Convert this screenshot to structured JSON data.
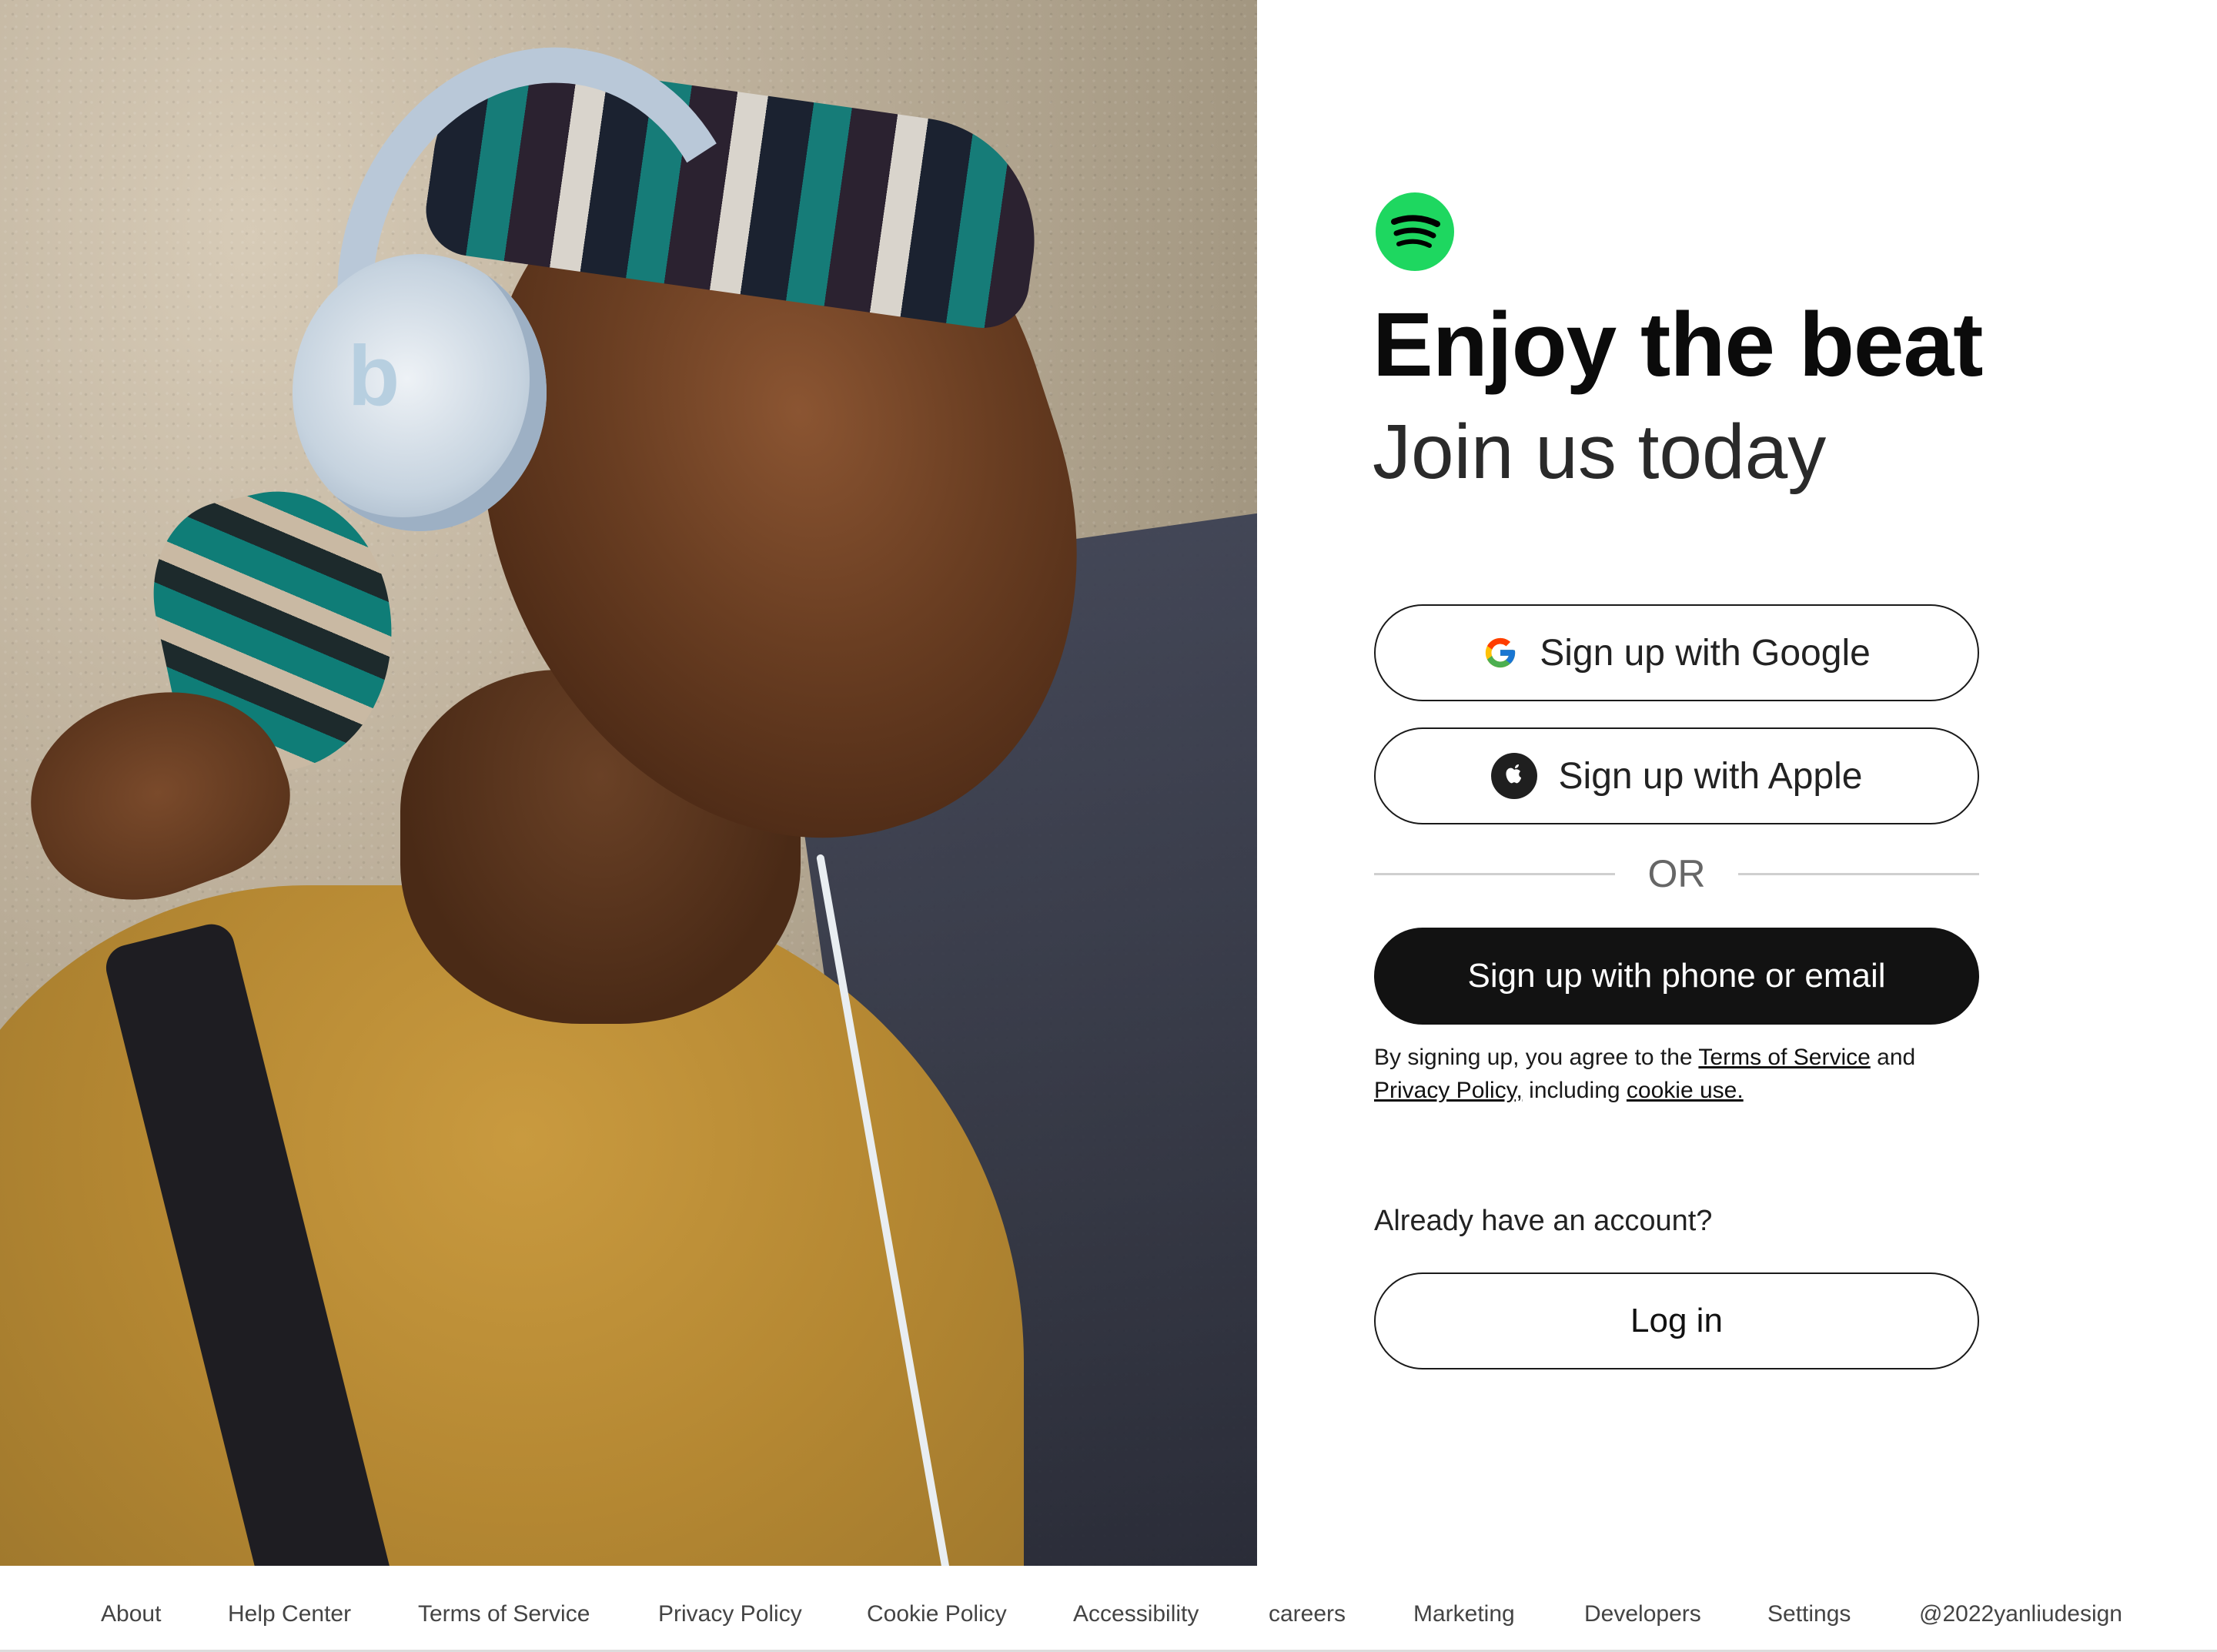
{
  "hero": {
    "headphone_brand_mark": "b"
  },
  "brand": {
    "logo_icon": "spotify-logo-icon",
    "accent_color": "#1ED760"
  },
  "main": {
    "headline": "Enjoy the beat",
    "subheadline": "Join us today",
    "google_button": {
      "label": "Sign up with Google",
      "icon": "google-icon"
    },
    "apple_button": {
      "label": "Sign up with Apple",
      "icon": "apple-icon"
    },
    "divider_text": "OR",
    "phone_email_button": {
      "label": "Sign up with phone or email"
    },
    "terms": {
      "prefix": "By signing up, you agree to the ",
      "terms_link": "Terms of Service",
      "and": " and",
      "privacy_link": "Privacy Policy,",
      "including": " including ",
      "cookie_link": "cookie use."
    },
    "already_text": "Already have an account?",
    "login_button": {
      "label": "Log in"
    }
  },
  "footer": {
    "links": [
      "About",
      "Help Center",
      "Terms of Service",
      "Privacy Policy",
      "Cookie Policy",
      "Accessibility",
      "careers",
      "Marketing",
      "Developers",
      "Settings",
      "@2022yanliudesign"
    ]
  }
}
